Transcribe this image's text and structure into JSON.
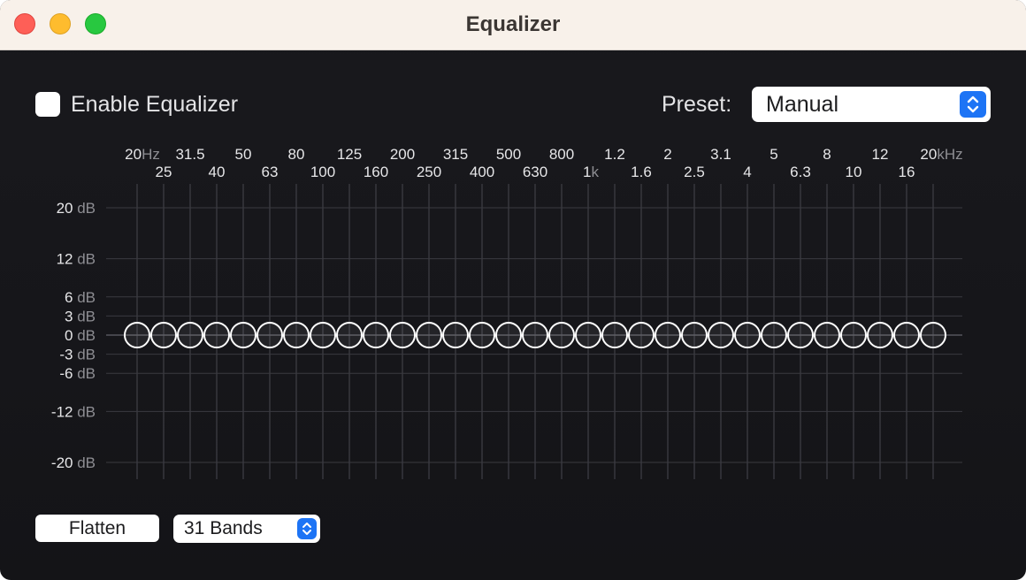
{
  "window": {
    "title": "Equalizer",
    "controls": [
      "close",
      "minimize",
      "zoom"
    ]
  },
  "enable": {
    "label": "Enable Equalizer",
    "checked": false
  },
  "preset": {
    "label": "Preset:",
    "value": "Manual"
  },
  "frequency_labels": {
    "top": [
      {
        "num": "20",
        "unit": "Hz"
      },
      {
        "num": "31.5"
      },
      {
        "num": "50"
      },
      {
        "num": "80"
      },
      {
        "num": "125"
      },
      {
        "num": "200"
      },
      {
        "num": "315"
      },
      {
        "num": "500"
      },
      {
        "num": "800"
      },
      {
        "num": "1.2"
      },
      {
        "num": "2"
      },
      {
        "num": "3.1"
      },
      {
        "num": "5"
      },
      {
        "num": "8"
      },
      {
        "num": "12"
      },
      {
        "num": "20",
        "unit": "kHz"
      }
    ],
    "bottom": [
      {
        "num": "25"
      },
      {
        "num": "40"
      },
      {
        "num": "63"
      },
      {
        "num": "100"
      },
      {
        "num": "160"
      },
      {
        "num": "250"
      },
      {
        "num": "400"
      },
      {
        "num": "630"
      },
      {
        "num": "1",
        "unit": "k"
      },
      {
        "num": "1.6"
      },
      {
        "num": "2.5"
      },
      {
        "num": "4"
      },
      {
        "num": "6.3"
      },
      {
        "num": "10"
      },
      {
        "num": "16"
      }
    ]
  },
  "db_scale": {
    "unit": "dB",
    "ticks": [
      {
        "value": 20,
        "label": "20"
      },
      {
        "value": 12,
        "label": "12"
      },
      {
        "value": 6,
        "label": "6"
      },
      {
        "value": 3,
        "label": "3"
      },
      {
        "value": 0,
        "label": "0"
      },
      {
        "value": -3,
        "label": "-3"
      },
      {
        "value": -6,
        "label": "-6"
      },
      {
        "value": -12,
        "label": "-12"
      },
      {
        "value": -20,
        "label": "-20"
      }
    ]
  },
  "bands": {
    "count": 31,
    "gains_db": [
      0,
      0,
      0,
      0,
      0,
      0,
      0,
      0,
      0,
      0,
      0,
      0,
      0,
      0,
      0,
      0,
      0,
      0,
      0,
      0,
      0,
      0,
      0,
      0,
      0,
      0,
      0,
      0,
      0,
      0,
      0
    ]
  },
  "flatten_label": "Flatten",
  "bands_select": {
    "value": "31 Bands"
  },
  "colors": {
    "background": "#17171b",
    "titlebar": "#f8f1ea",
    "grid": "#3a3a40",
    "handle_stroke": "#ffffff",
    "accent": "#1d74f5"
  }
}
